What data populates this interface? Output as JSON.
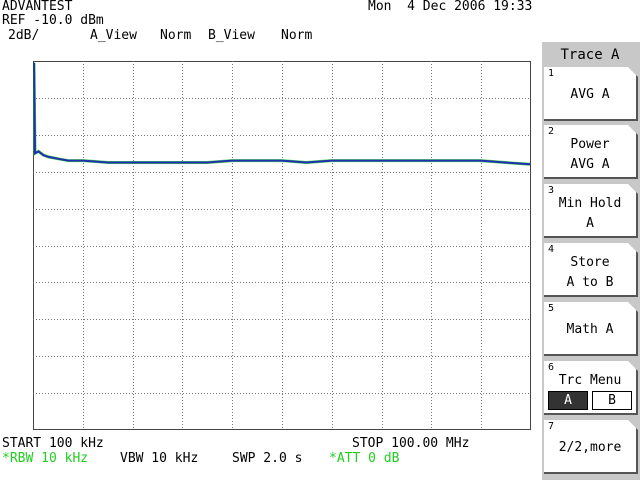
{
  "header": {
    "brand": "ADVANTEST",
    "datetime": "Mon  4 Dec 2006 19:33",
    "ref": "REF -10.0 dBm",
    "scale": "2dB/",
    "a_view": "A_View",
    "a_norm": "Norm",
    "b_view": "B_View",
    "b_norm": "Norm"
  },
  "footer": {
    "start": "START 100 kHz",
    "stop": "STOP 100.00 MHz",
    "rbw": "*RBW 10 kHz",
    "vbw": "VBW 10 kHz",
    "swp": "SWP 2.0 s",
    "att": "*ATT 0 dB"
  },
  "panel": {
    "title": "Trace A",
    "keys": [
      {
        "num": "1",
        "line1": "AVG A",
        "line2": ""
      },
      {
        "num": "2",
        "line1": "Power",
        "line2": "AVG A"
      },
      {
        "num": "3",
        "line1": "Min Hold",
        "line2": "A"
      },
      {
        "num": "4",
        "line1": "Store",
        "line2": "A to B"
      },
      {
        "num": "5",
        "line1": "Math A",
        "line2": ""
      },
      {
        "num": "6",
        "line1": "Trc Menu",
        "opt_a": "A",
        "opt_b": "B"
      },
      {
        "num": "7",
        "line1": "2/2,more",
        "line2": ""
      }
    ]
  },
  "colors": {
    "trace_a": "#1f2fb0",
    "trace_b": "#22cc22",
    "grid": "#777777",
    "panel_bg": "#c8c8c8",
    "highlight_text": "#22cc22"
  },
  "chart_data": {
    "type": "line",
    "x_unit": "MHz",
    "y_unit": "dB below REF",
    "xlim": [
      0.1,
      100.0
    ],
    "ylim": [
      -20,
      0
    ],
    "grid": true,
    "series": [
      {
        "x": [
          0.1,
          0.3,
          1,
          2,
          3,
          5,
          7,
          10,
          15,
          20,
          25,
          30,
          35,
          40,
          45,
          50,
          55,
          60,
          65,
          70,
          75,
          80,
          85,
          90,
          95,
          100
        ],
        "values": [
          -0.1,
          -5.0,
          -4.9,
          -5.1,
          -5.2,
          -5.3,
          -5.4,
          -5.4,
          -5.5,
          -5.5,
          -5.5,
          -5.5,
          -5.5,
          -5.4,
          -5.4,
          -5.4,
          -5.5,
          -5.4,
          -5.4,
          -5.4,
          -5.4,
          -5.4,
          -5.4,
          -5.4,
          -5.5,
          -5.6
        ]
      }
    ]
  }
}
